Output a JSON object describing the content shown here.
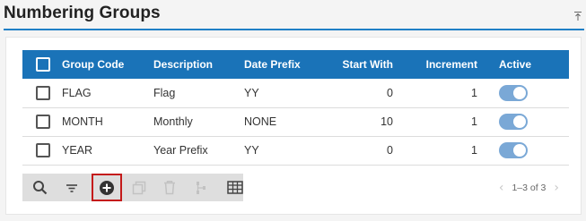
{
  "page": {
    "title": "Numbering Groups"
  },
  "table": {
    "headers": {
      "code": "Group Code",
      "description": "Description",
      "prefix": "Date Prefix",
      "start": "Start With",
      "increment": "Increment",
      "active": "Active"
    },
    "rows": [
      {
        "code": "FLAG",
        "description": "Flag",
        "prefix": "YY",
        "start": "0",
        "increment": "1",
        "active": true
      },
      {
        "code": "MONTH",
        "description": "Monthly",
        "prefix": "NONE",
        "start": "10",
        "increment": "1",
        "active": true
      },
      {
        "code": "YEAR",
        "description": "Year Prefix",
        "prefix": "YY",
        "start": "0",
        "increment": "1",
        "active": true
      }
    ]
  },
  "toolbar": {
    "buttons": [
      {
        "name": "search-icon",
        "enabled": true
      },
      {
        "name": "filter-icon",
        "enabled": true
      },
      {
        "name": "add-icon",
        "enabled": true,
        "highlighted": true
      },
      {
        "name": "copy-icon",
        "enabled": false
      },
      {
        "name": "delete-icon",
        "enabled": false
      },
      {
        "name": "hierarchy-icon",
        "enabled": false
      },
      {
        "name": "grid-view-icon",
        "enabled": true
      }
    ]
  },
  "pager": {
    "range": "1–3 of 3"
  },
  "colors": {
    "header_bg": "#1a73b8",
    "title_rule": "#1f7fc6",
    "toggle_on": "#7aa8d6",
    "highlight_border": "#c41a1a"
  }
}
